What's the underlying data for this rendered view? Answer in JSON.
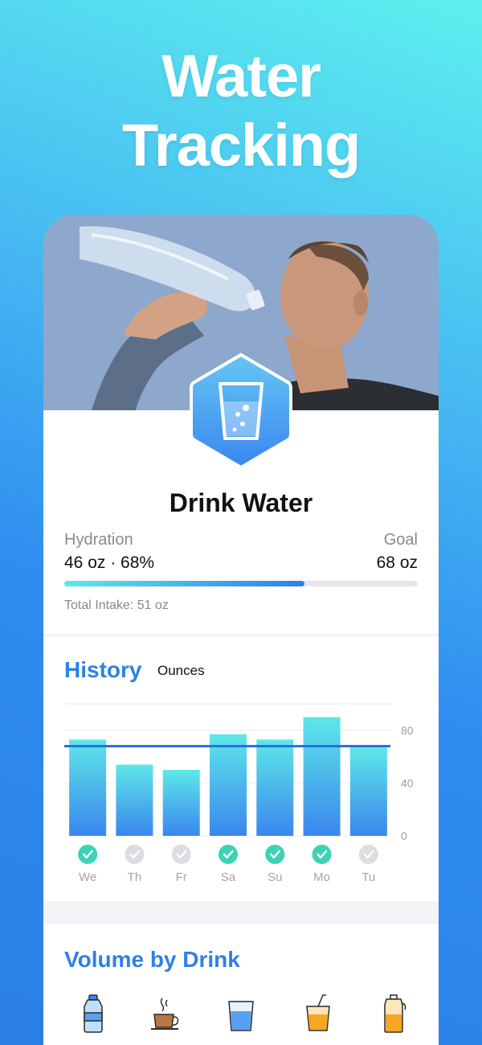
{
  "hero": {
    "line1": "Water",
    "line2": "Tracking"
  },
  "goal_card": {
    "title": "Drink Water",
    "hydration_label": "Hydration",
    "goal_label": "Goal",
    "hydration_value": "46 oz · 68%",
    "goal_value": "68 oz",
    "progress_fraction": 0.68,
    "total_intake": "Total Intake: 51 oz"
  },
  "history": {
    "title": "History",
    "unit": "Ounces"
  },
  "chart_data": {
    "type": "bar",
    "categories": [
      "We",
      "Th",
      "Fr",
      "Sa",
      "Su",
      "Mo",
      "Tu"
    ],
    "values": [
      73,
      54,
      50,
      77,
      73,
      90,
      67
    ],
    "goal_line": 68,
    "completed": [
      true,
      false,
      false,
      true,
      true,
      true,
      false
    ],
    "ylim": [
      0,
      100
    ],
    "yticks": [
      0,
      40,
      80
    ],
    "colors": {
      "bar_top": "#5de8e8",
      "bar_bottom": "#3b86ee",
      "goal_line": "#2b6fe0",
      "check": "#3cd3b5",
      "check_off": "#dcdde0"
    }
  },
  "volume": {
    "title": "Volume by Drink",
    "icons": [
      "water-bottle-icon",
      "coffee-cup-icon",
      "water-glass-icon",
      "juice-cup-icon",
      "shaker-bottle-icon"
    ]
  }
}
